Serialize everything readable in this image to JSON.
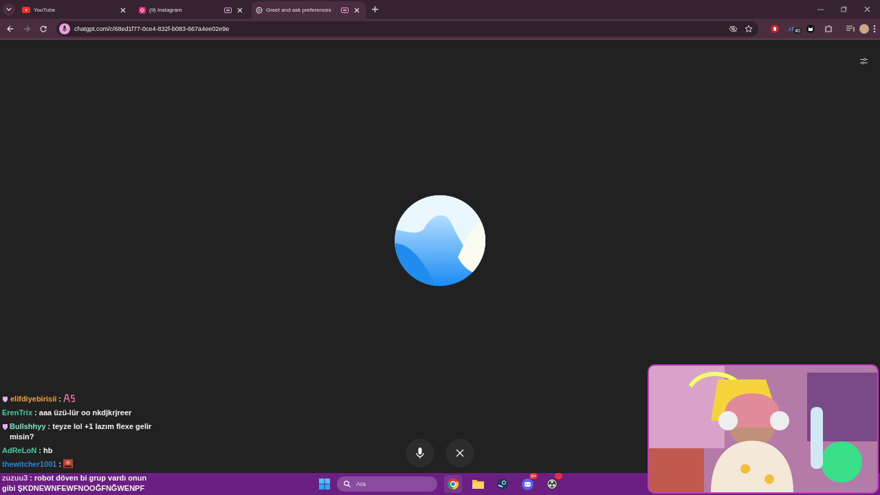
{
  "tabs": [
    {
      "title": "YouTube",
      "kind": "video",
      "selected": false,
      "media": false
    },
    {
      "title": "(9) Instagram",
      "kind": "camera",
      "selected": false,
      "media": true
    },
    {
      "title": "Greet and ask preferences",
      "kind": "knot",
      "selected": true,
      "media": true
    }
  ],
  "address": {
    "url": "chatgpt.com/c/68ed1f77-0ce4-832f-b083-667a4ee02e9e"
  },
  "extensions": [
    {
      "kind": "hand"
    },
    {
      "kind": "waves",
      "badge": "40"
    },
    {
      "kind": "cat"
    },
    {
      "kind": "puzzle"
    }
  ],
  "chat": [
    {
      "user": "elifdiyebirisii",
      "color": "#e8a23a",
      "badge": true,
      "kind": "emote",
      "separator": ":"
    },
    {
      "user": "ErenTrix",
      "color": "#3ecf9a",
      "badge": false,
      "kind": "text",
      "separator": ":",
      "text": "aaa üzü-lür oo nkdjkrjreer"
    },
    {
      "user": "Bullshhyy",
      "color": "#7fe0c0",
      "badge": true,
      "kind": "text",
      "separator": ":",
      "text": "teyze lol +1 lazım flexe gelir misin?"
    },
    {
      "user": "AdReLoN",
      "color": "#3ecf9a",
      "badge": false,
      "kind": "text",
      "separator": ":",
      "text": "hb"
    },
    {
      "user": "thewitcher1001",
      "color": "#2f7fd8",
      "badge": false,
      "kind": "emote",
      "separator": ":"
    },
    {
      "user": "zuzuu3",
      "color": "#e6c0e6",
      "badge": false,
      "kind": "text",
      "separator": ":",
      "text": "robot döven bi grup vardı onun gibi ŞKDNEWNFEWFNOOĞFNĞWENPF"
    }
  ],
  "taskbar": {
    "search": {
      "placeholder": "Ara"
    },
    "apps": [
      {
        "kind": "browser",
        "active": true
      },
      {
        "kind": "folder",
        "active": false
      },
      {
        "kind": "steam",
        "active": false
      },
      {
        "kind": "discord",
        "active": false,
        "badge": "9+"
      },
      {
        "kind": "recorder",
        "active": false,
        "dot": true
      }
    ]
  }
}
